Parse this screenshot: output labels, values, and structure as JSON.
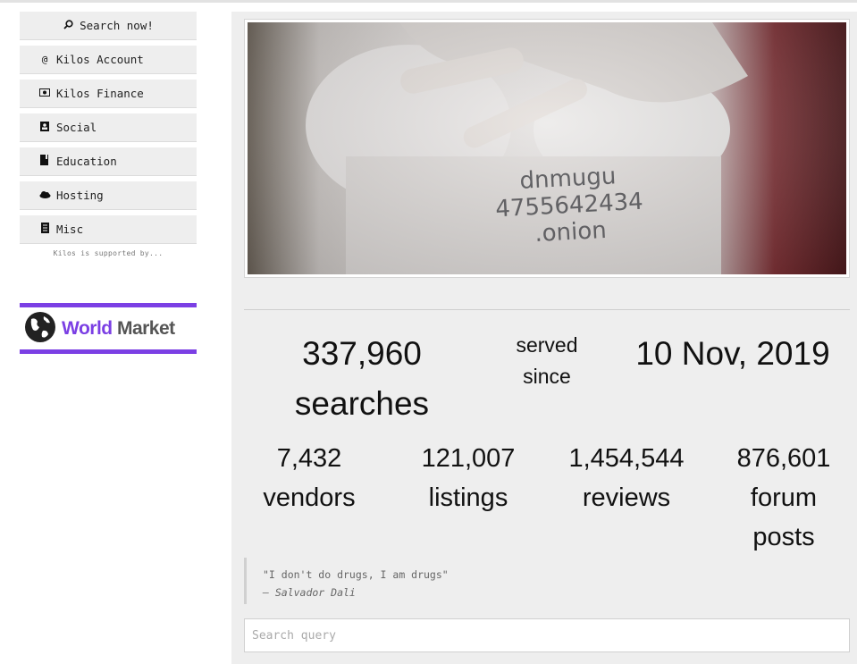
{
  "nav": {
    "items": [
      {
        "label": "Search now!",
        "icon": "search-icon",
        "glyph": "⚲"
      },
      {
        "label": "Kilos Account",
        "icon": "at-icon",
        "glyph": "@"
      },
      {
        "label": "Kilos Finance",
        "icon": "money-icon",
        "glyph": "▣"
      },
      {
        "label": "Social",
        "icon": "contact-card-icon",
        "glyph": "▪"
      },
      {
        "label": "Education",
        "icon": "book-icon",
        "glyph": "▮"
      },
      {
        "label": "Hosting",
        "icon": "cloud-icon",
        "glyph": "☁"
      },
      {
        "label": "Misc",
        "icon": "document-icon",
        "glyph": "▤"
      }
    ],
    "supported_text": "Kilos is supported by..."
  },
  "sponsor": {
    "word1": "World",
    "word2": "Market",
    "accent": "#7b3fe4"
  },
  "photo": {
    "handwriting_line1": "dnmugu",
    "handwriting_line2": "4755642434",
    "handwriting_line3": ".onion"
  },
  "stats": {
    "searches_number": "337,960",
    "searches_label": "searches",
    "served_line1": "served",
    "served_line2": "since",
    "since_date": "10 Nov, 2019",
    "vendors_number": "7,432",
    "vendors_label": "vendors",
    "listings_number": "121,007",
    "listings_label": "listings",
    "reviews_number": "1,454,544",
    "reviews_label": "reviews",
    "forum_number": "876,601",
    "forum_label_1": "forum",
    "forum_label_2": "posts"
  },
  "quote": {
    "text": "\"I don't do drugs, I am drugs\"",
    "author": "— Salvador Dali"
  },
  "search": {
    "placeholder": "Search query"
  }
}
